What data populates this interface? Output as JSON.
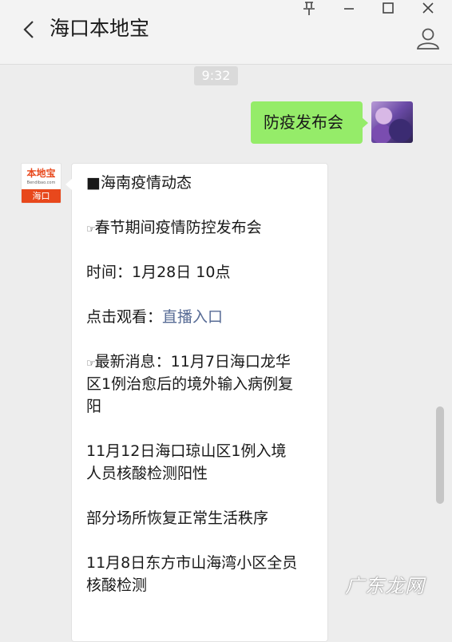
{
  "header": {
    "title": "海口本地宝",
    "window_controls": [
      "pin-icon",
      "minimize-icon",
      "maximize-icon",
      "close-icon"
    ]
  },
  "chat": {
    "timestamp": "9:32",
    "sent_message": "防疫发布会",
    "bot_avatar": {
      "brand": "本地宝",
      "site": "Bendibao.com",
      "city": "海口"
    },
    "received": {
      "l1": "■海南疫情动态",
      "l2_icon": "☞",
      "l2": "春节期间疫情防控发布会",
      "l3": "时间：1月28日 10点",
      "l4_prefix": "点击观看：",
      "l4_link": "直播入口",
      "l5_icon": "☞",
      "l5a": "最新消息：11月7日海口龙华",
      "l5b": "区1例治愈后的境外输入病例复",
      "l5c": "阳",
      "l6a": "11月12日海口琼山区1例入境",
      "l6b": "人员核酸检测阳性",
      "l7": "部分场所恢复正常生活秩序",
      "l8a": "11月8日东方市山海湾小区全员",
      "l8b": "核酸检测"
    }
  },
  "watermark": "广东龙网",
  "colors": {
    "sent_bubble": "#95ec69",
    "link": "#576b95",
    "brand": "#e8481c"
  }
}
